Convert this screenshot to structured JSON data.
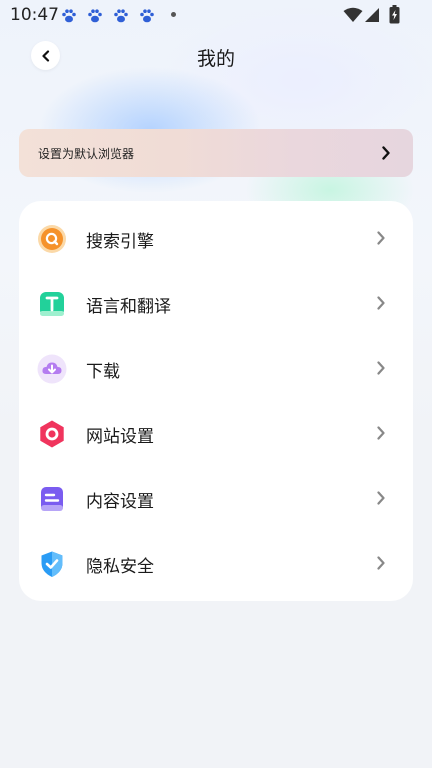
{
  "status_bar": {
    "time": "10:47",
    "notification_icons": [
      "paw-icon",
      "paw-icon",
      "paw-icon",
      "paw-icon"
    ]
  },
  "header": {
    "title": "我的"
  },
  "banner": {
    "text": "设置为默认浏览器"
  },
  "menu": {
    "items": [
      {
        "label": "搜索引擎",
        "icon": "search-engine-icon",
        "color": "#f5922b"
      },
      {
        "label": "语言和翻译",
        "icon": "translate-icon",
        "color": "#22d19a"
      },
      {
        "label": "下载",
        "icon": "download-cloud-icon",
        "color": "#b47cf0"
      },
      {
        "label": "网站设置",
        "icon": "website-settings-icon",
        "color": "#f0345d"
      },
      {
        "label": "内容设置",
        "icon": "content-settings-icon",
        "color": "#7a5cf0"
      },
      {
        "label": "隐私安全",
        "icon": "shield-check-icon",
        "color": "#2a9cf5"
      }
    ]
  }
}
